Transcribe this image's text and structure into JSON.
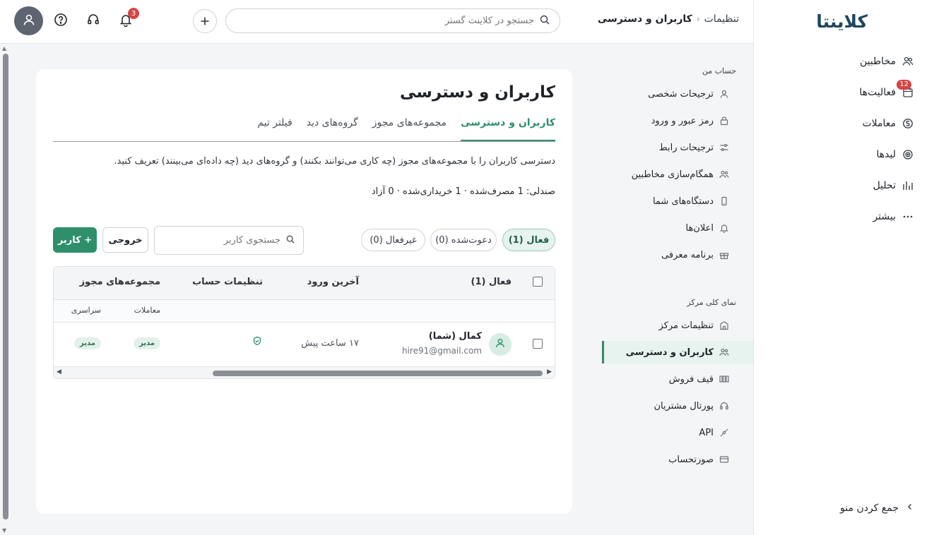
{
  "app": {
    "logo_text": "کلاینتا"
  },
  "main_nav": {
    "items": [
      {
        "label": "مخاطبین",
        "icon": "contacts-icon"
      },
      {
        "label": "فعالیت‌ها",
        "icon": "calendar-icon",
        "badge": "12"
      },
      {
        "label": "معاملات",
        "icon": "deals-icon"
      },
      {
        "label": "لیدها",
        "icon": "target-icon"
      },
      {
        "label": "تحلیل",
        "icon": "chart-icon"
      },
      {
        "label": "بیشتر",
        "icon": "more-icon"
      }
    ],
    "collapse_label": "جمع کردن منو"
  },
  "header": {
    "breadcrumb": {
      "parent": "تنظیمات",
      "current": "کاربران و دسترسی"
    },
    "search_placeholder": "جستجو در کلاینت گستر",
    "notifications_count": "3"
  },
  "settings_nav": {
    "my_account_label": "حساب من",
    "my_account_items": [
      {
        "label": "ترجیحات شخصی",
        "icon": "user-icon"
      },
      {
        "label": "رمز عبور و ورود",
        "icon": "lock-icon"
      },
      {
        "label": "ترجیحات رابط",
        "icon": "sliders-icon"
      },
      {
        "label": "همگام‌سازی مخاطبین",
        "icon": "sync-contacts-icon"
      },
      {
        "label": "دستگاه‌های شما",
        "icon": "device-icon"
      },
      {
        "label": "اعلان‌ها",
        "icon": "bell-icon"
      },
      {
        "label": "برنامه معرفی",
        "icon": "gift-icon"
      }
    ],
    "center_label": "نمای کلی مرکز",
    "center_items": [
      {
        "label": "تنظیمات مرکز",
        "icon": "building-icon"
      },
      {
        "label": "کاربران و دسترسی",
        "icon": "users-icon",
        "active": true
      },
      {
        "label": "قیف فروش",
        "icon": "pipeline-icon"
      },
      {
        "label": "پورتال مشتریان",
        "icon": "headset-icon"
      },
      {
        "label": "API",
        "icon": "api-icon"
      },
      {
        "label": "صورتحساب",
        "icon": "card-icon"
      }
    ]
  },
  "page": {
    "title": "کاربران و دسترسی",
    "tabs": [
      "کاربران و دسترسی",
      "مجموعه‌های مجوز",
      "گروه‌های دید",
      "فیلتر تیم"
    ],
    "description": "دسترسی کاربران را با مجموعه‌های مجوز (چه کاری می‌توانند بکنند) و گروه‌های دید (چه داده‌ای می‌بینند) تعریف کنید.",
    "seats": "صندلی: 1 مصرف‌شده · 1 خریداری‌شده · 0 آزاد",
    "filters": [
      "فعال (1)",
      "دعوت‌شده (0)",
      "غیرفعال (0)"
    ],
    "user_search_placeholder": "جستجوی کاربر",
    "export_label": "خروجی",
    "add_user_label": "+ کاربر"
  },
  "table": {
    "headers": {
      "name": "فعال (1)",
      "last_login": "آخرین ورود",
      "account_settings": "تنظیمات حساب",
      "permission_sets": "مجموعه‌های مجوز"
    },
    "subheaders": {
      "deals": "معاملات",
      "global": "سراسری"
    },
    "rows": [
      {
        "name": "کمال (شما)",
        "email": "hire91@gmail.com",
        "last_login": "۱۷ ساعت پیش",
        "deals_role": "مدیر",
        "global_role": "مدیر"
      }
    ]
  },
  "colors": {
    "accent": "#2f8f6b",
    "badge": "#d64545",
    "brand": "#1d4761"
  }
}
